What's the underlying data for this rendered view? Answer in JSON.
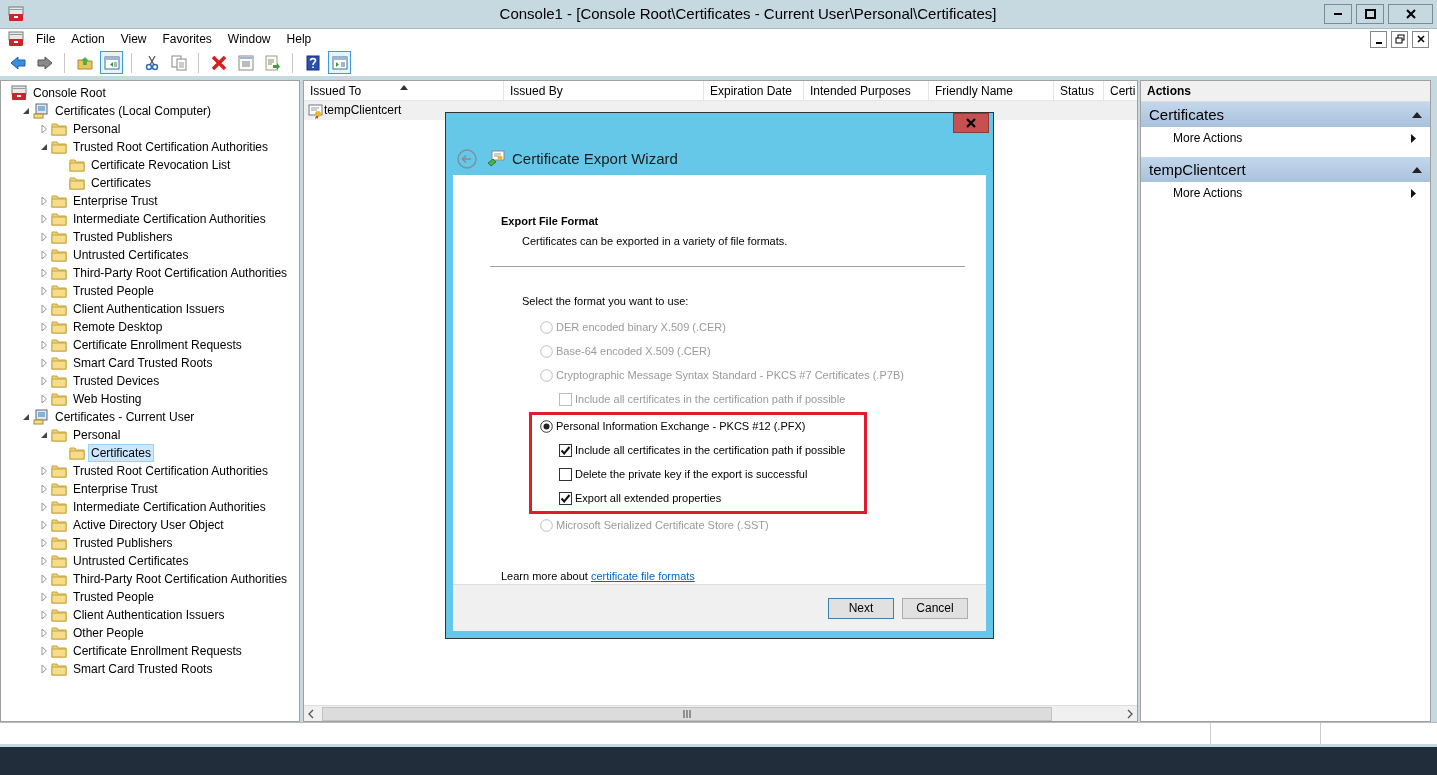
{
  "window": {
    "title": "Console1 - [Console Root\\Certificates - Current User\\Personal\\Certificates]"
  },
  "menu": [
    "File",
    "Action",
    "View",
    "Favorites",
    "Window",
    "Help"
  ],
  "toolbar": [
    [
      {
        "kind": "back",
        "pressed": false
      },
      {
        "kind": "forward",
        "pressed": false
      }
    ],
    [
      {
        "kind": "up",
        "pressed": false
      },
      {
        "kind": "tree",
        "pressed": true
      }
    ],
    [
      {
        "kind": "cut",
        "pressed": false
      },
      {
        "kind": "copy",
        "pressed": false
      }
    ],
    [
      {
        "kind": "delete",
        "pressed": false
      },
      {
        "kind": "properties",
        "pressed": false
      },
      {
        "kind": "export",
        "pressed": false
      }
    ],
    [
      {
        "kind": "help",
        "pressed": false
      },
      {
        "kind": "actionpane",
        "pressed": true
      }
    ]
  ],
  "tree": [
    {
      "label": "Console Root",
      "kind": "root",
      "selected": false,
      "children": [
        {
          "label": "Certificates (Local Computer)",
          "kind": "store",
          "expanded": true,
          "selected": false,
          "children": [
            {
              "label": "Personal",
              "kind": "folder",
              "expanded": false,
              "selected": false
            },
            {
              "label": "Trusted Root Certification Authorities",
              "kind": "folder",
              "expanded": true,
              "selected": false,
              "children": [
                {
                  "label": "Certificate Revocation List",
                  "kind": "folder",
                  "selected": false
                },
                {
                  "label": "Certificates",
                  "kind": "folder",
                  "selected": false
                }
              ]
            },
            {
              "label": "Enterprise Trust",
              "kind": "folder",
              "expanded": false,
              "selected": false
            },
            {
              "label": "Intermediate Certification Authorities",
              "kind": "folder",
              "expanded": false,
              "selected": false
            },
            {
              "label": "Trusted Publishers",
              "kind": "folder",
              "expanded": false,
              "selected": false
            },
            {
              "label": "Untrusted Certificates",
              "kind": "folder",
              "expanded": false,
              "selected": false
            },
            {
              "label": "Third-Party Root Certification Authorities",
              "kind": "folder",
              "expanded": false,
              "selected": false
            },
            {
              "label": "Trusted People",
              "kind": "folder",
              "expanded": false,
              "selected": false
            },
            {
              "label": "Client Authentication Issuers",
              "kind": "folder",
              "expanded": false,
              "selected": false
            },
            {
              "label": "Remote Desktop",
              "kind": "folder",
              "expanded": false,
              "selected": false
            },
            {
              "label": "Certificate Enrollment Requests",
              "kind": "folder",
              "expanded": false,
              "selected": false
            },
            {
              "label": "Smart Card Trusted Roots",
              "kind": "folder",
              "expanded": false,
              "selected": false
            },
            {
              "label": "Trusted Devices",
              "kind": "folder",
              "expanded": false,
              "selected": false
            },
            {
              "label": "Web Hosting",
              "kind": "folder",
              "expanded": false,
              "selected": false
            }
          ]
        },
        {
          "label": "Certificates - Current User",
          "kind": "store",
          "expanded": true,
          "selected": false,
          "children": [
            {
              "label": "Personal",
              "kind": "folder",
              "expanded": true,
              "selected": false,
              "children": [
                {
                  "label": "Certificates",
                  "kind": "folder",
                  "selected": true
                }
              ]
            },
            {
              "label": "Trusted Root Certification Authorities",
              "kind": "folder",
              "expanded": false,
              "selected": false
            },
            {
              "label": "Enterprise Trust",
              "kind": "folder",
              "expanded": false,
              "selected": false
            },
            {
              "label": "Intermediate Certification Authorities",
              "kind": "folder",
              "expanded": false,
              "selected": false
            },
            {
              "label": "Active Directory User Object",
              "kind": "folder",
              "expanded": false,
              "selected": false
            },
            {
              "label": "Trusted Publishers",
              "kind": "folder",
              "expanded": false,
              "selected": false
            },
            {
              "label": "Untrusted Certificates",
              "kind": "folder",
              "expanded": false,
              "selected": false
            },
            {
              "label": "Third-Party Root Certification Authorities",
              "kind": "folder",
              "expanded": false,
              "selected": false
            },
            {
              "label": "Trusted People",
              "kind": "folder",
              "expanded": false,
              "selected": false
            },
            {
              "label": "Client Authentication Issuers",
              "kind": "folder",
              "expanded": false,
              "selected": false
            },
            {
              "label": "Other People",
              "kind": "folder",
              "expanded": false,
              "selected": false
            },
            {
              "label": "Certificate Enrollment Requests",
              "kind": "folder",
              "expanded": false,
              "selected": false
            },
            {
              "label": "Smart Card Trusted Roots",
              "kind": "folder",
              "expanded": false,
              "selected": false
            }
          ]
        }
      ]
    }
  ],
  "list": {
    "columns": [
      {
        "label": "Issued To",
        "sorted": true
      },
      {
        "label": "Issued By",
        "sorted": false
      },
      {
        "label": "Expiration Date",
        "sorted": false
      },
      {
        "label": "Intended Purposes",
        "sorted": false
      },
      {
        "label": "Friendly Name",
        "sorted": false
      },
      {
        "label": "Status",
        "sorted": false
      },
      {
        "label": "Certi",
        "sorted": false
      }
    ],
    "rows": [
      {
        "cells": [
          "tempClientcert"
        ]
      }
    ]
  },
  "actions": {
    "title": "Actions",
    "groups": [
      {
        "title": "Certificates",
        "items": [
          "More Actions"
        ]
      },
      {
        "title": "tempClientcert",
        "items": [
          "More Actions"
        ]
      }
    ]
  },
  "dialog": {
    "title": "Certificate Export Wizard",
    "heading": "Export File Format",
    "subheading": "Certificates can be exported in a variety of file formats.",
    "prompt": "Select the format you want to use:",
    "options": [
      {
        "kind": "radio",
        "label": "DER encoded binary X.509 (.CER)",
        "selected": false,
        "disabled": true,
        "highlighted": false
      },
      {
        "kind": "radio",
        "label": "Base-64 encoded X.509 (.CER)",
        "selected": false,
        "disabled": true,
        "highlighted": false
      },
      {
        "kind": "radio",
        "label": "Cryptographic Message Syntax Standard - PKCS #7 Certificates (.P7B)",
        "selected": false,
        "disabled": true,
        "highlighted": false
      },
      {
        "kind": "checkbox",
        "label": "Include all certificates in the certification path if possible",
        "checked": false,
        "disabled": true,
        "highlighted": false
      },
      {
        "kind": "radio",
        "label": "Personal Information Exchange - PKCS #12 (.PFX)",
        "selected": true,
        "disabled": false,
        "highlighted": true
      },
      {
        "kind": "checkbox",
        "label": "Include all certificates in the certification path if possible",
        "checked": true,
        "disabled": false,
        "highlighted": true
      },
      {
        "kind": "checkbox",
        "label": "Delete the private key if the export is successful",
        "checked": false,
        "disabled": false,
        "highlighted": true
      },
      {
        "kind": "checkbox",
        "label": "Export all extended properties",
        "checked": true,
        "disabled": false,
        "highlighted": true
      },
      {
        "kind": "radio",
        "label": "Microsoft Serialized Certificate Store (.SST)",
        "selected": false,
        "disabled": true,
        "highlighted": false
      }
    ],
    "learn_more": {
      "text": "Learn more about",
      "link": "certificate file formats"
    },
    "buttons": [
      {
        "label": "Next",
        "default": true
      },
      {
        "label": "Cancel",
        "default": false
      }
    ]
  }
}
